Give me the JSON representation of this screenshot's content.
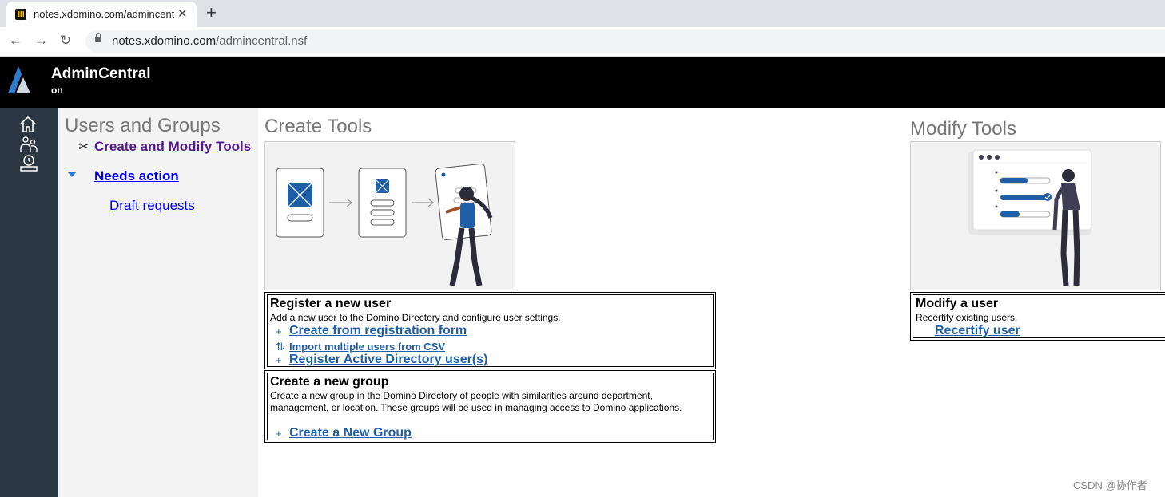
{
  "browser": {
    "tab_title": "notes.xdomino.com/admincentral.nsf",
    "tab_close": "✕",
    "new_tab": "+",
    "back": "←",
    "forward": "→",
    "reload": "↻",
    "url_host": "notes.xdomino.com",
    "url_path": "/admincentral.nsf"
  },
  "header": {
    "title": "AdminCentral",
    "subtitle": "on"
  },
  "nav": {
    "title": "Users and Groups",
    "tools_link": "Create and Modify Tools",
    "needs_action": "Needs action",
    "draft_requests": "Draft requests"
  },
  "create_tools": {
    "title": "Create Tools",
    "register_user": {
      "title": "Register a new user",
      "description": "Add a new user to the Domino Directory and configure user settings.",
      "actions": [
        {
          "icon": "+",
          "label": "Create from registration form"
        },
        {
          "icon": "⇅",
          "label": "Import multiple users from CSV"
        },
        {
          "icon": "+",
          "label": "Register Active Directory user(s)"
        }
      ]
    },
    "create_group": {
      "title": "Create a new group",
      "description": "Create a new group in the Domino Directory of people with similarities around department, management, or location. These groups will be used in managing access to Domino applications.",
      "actions": [
        {
          "icon": "+",
          "label": "Create a New Group"
        }
      ]
    }
  },
  "modify_tools": {
    "title": "Modify Tools",
    "modify_user": {
      "title": "Modify a user",
      "description": "Recertify existing users.",
      "action": "Recertify user"
    }
  },
  "watermark": "CSDN @协作者",
  "colors": {
    "header_bg": "#000000",
    "rail_bg": "#2b3742",
    "link_blue": "#1f5fa8",
    "visited": "#551a8b",
    "illus_blue": "#1f5fa8"
  }
}
